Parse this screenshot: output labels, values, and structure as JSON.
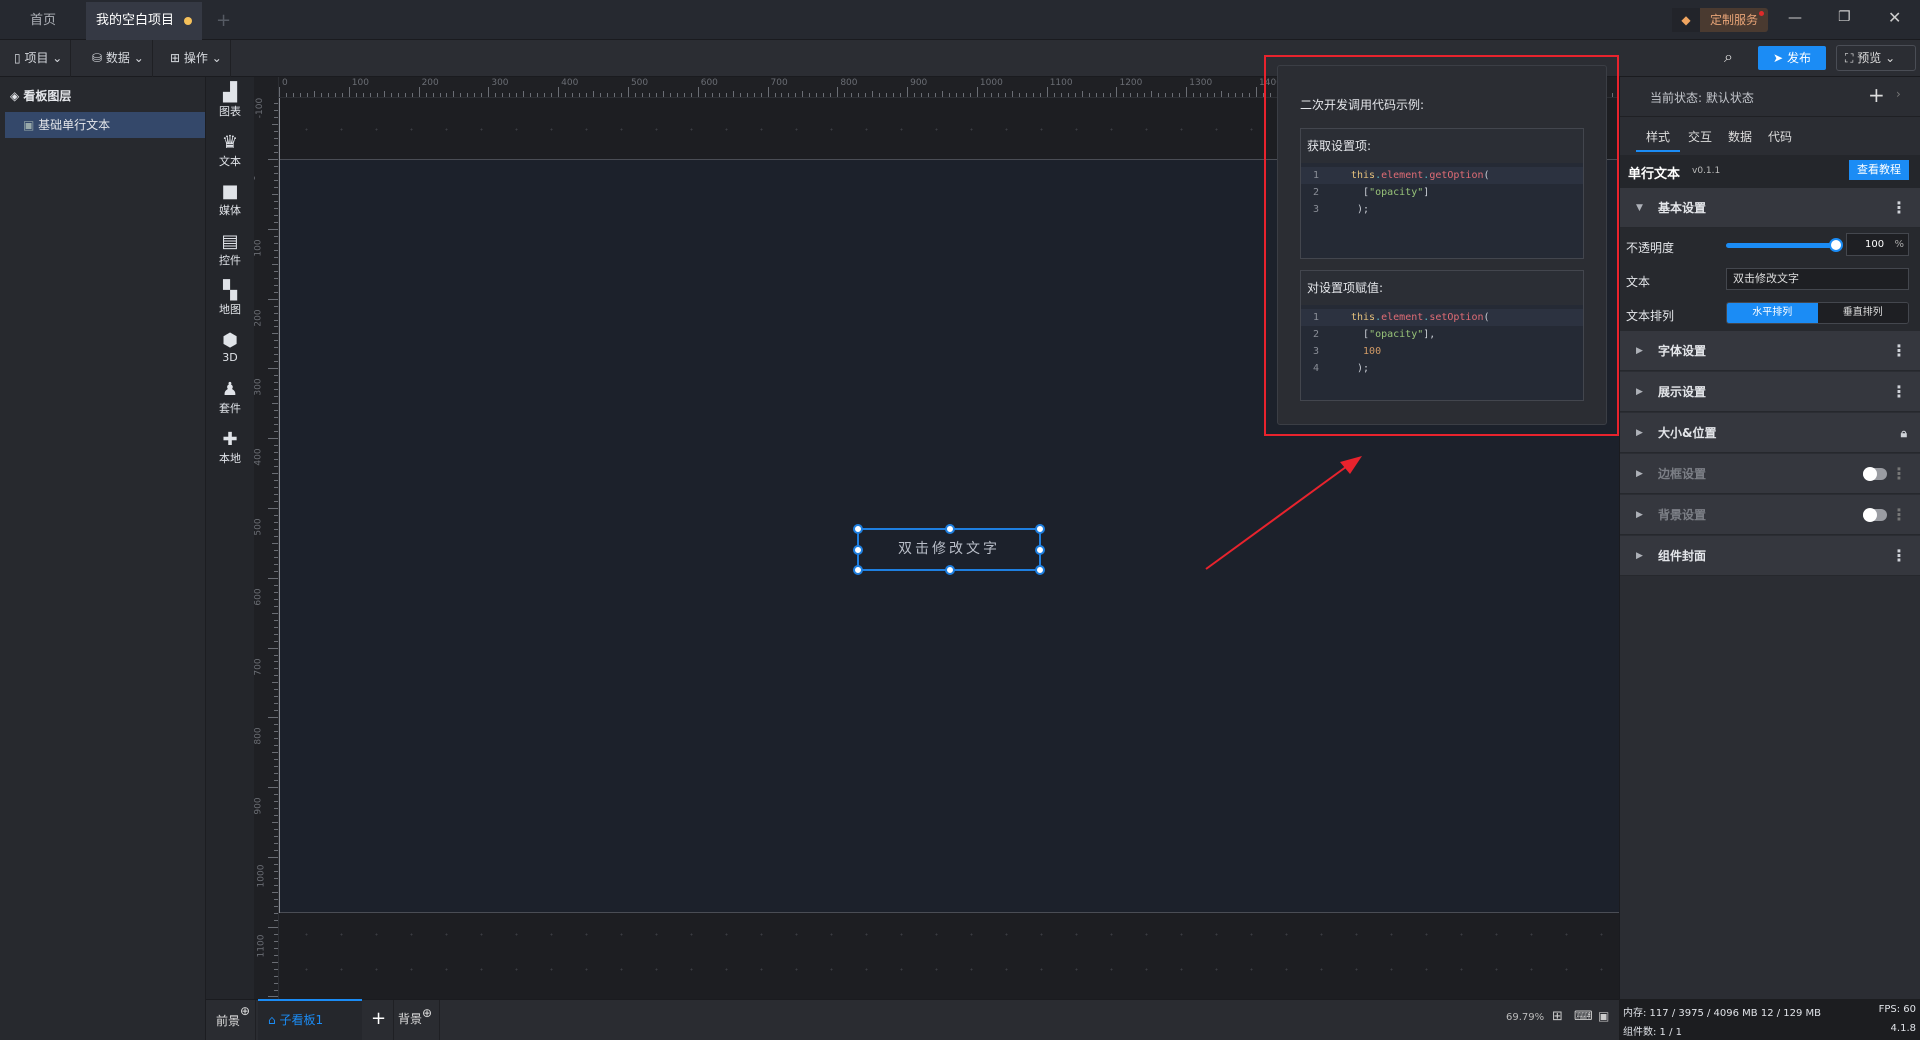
{
  "titlebar": {
    "tabs": [
      {
        "label": "首页"
      },
      {
        "label": "我的空白项目"
      }
    ],
    "add_tab": "+",
    "custom_service": "定制服务"
  },
  "toolbar": {
    "menus": [
      {
        "label": "项目"
      },
      {
        "label": "数据"
      },
      {
        "label": "操作"
      }
    ],
    "publish": "发布",
    "preview": "预览"
  },
  "layers": {
    "title": "看板图层",
    "items": [
      {
        "label": "基础单行文本"
      }
    ]
  },
  "iconbar": [
    {
      "label": "图表",
      "icon": "chart-icon"
    },
    {
      "label": "文本",
      "icon": "text-icon"
    },
    {
      "label": "媒体",
      "icon": "media-icon"
    },
    {
      "label": "控件",
      "icon": "control-icon"
    },
    {
      "label": "地图",
      "icon": "map-icon"
    },
    {
      "label": "3D",
      "icon": "cube-icon"
    },
    {
      "label": "套件",
      "icon": "kit-icon"
    },
    {
      "label": "本地",
      "icon": "puzzle-icon"
    }
  ],
  "ruler": {
    "h_labels": [
      0,
      100,
      200,
      300,
      400,
      500,
      600,
      700,
      800,
      900,
      1000,
      1100,
      1200,
      1300,
      1400
    ],
    "v_labels": [
      -100,
      0,
      100,
      200,
      300,
      400,
      500,
      600,
      700,
      800,
      900,
      1000,
      1100
    ]
  },
  "canvas": {
    "element_text": "双击修改文字"
  },
  "popup": {
    "title": "二次开发调用代码示例:",
    "get": {
      "title": "获取设置项:",
      "lines": [
        [
          [
            "kw",
            "this"
          ],
          [
            "dot",
            "."
          ],
          [
            "fn",
            "element"
          ],
          [
            "dot",
            "."
          ],
          [
            "fn",
            "getOption"
          ],
          [
            "p",
            "("
          ]
        ],
        [
          [
            "p",
            "  ["
          ],
          [
            "str",
            "\"opacity\""
          ],
          [
            "p",
            "]"
          ]
        ],
        [
          [
            "p",
            " );"
          ]
        ]
      ]
    },
    "set": {
      "title": "对设置项赋值:",
      "lines": [
        [
          [
            "kw",
            "this"
          ],
          [
            "dot",
            "."
          ],
          [
            "fn",
            "element"
          ],
          [
            "dot",
            "."
          ],
          [
            "fn",
            "setOption"
          ],
          [
            "p",
            "("
          ]
        ],
        [
          [
            "p",
            "  ["
          ],
          [
            "str",
            "\"opacity\""
          ],
          [
            "p",
            "],"
          ]
        ],
        [
          [
            "num",
            "  100"
          ]
        ],
        [
          [
            "p",
            " );"
          ]
        ]
      ]
    }
  },
  "rightpanel": {
    "state_label": "当前状态:",
    "state_value": "默认状态",
    "tabs": [
      "样式",
      "交互",
      "数据",
      "代码"
    ],
    "component_name": "单行文本",
    "version": "v0.1.1",
    "tutorial": "查看教程",
    "basic": {
      "title": "基本设置",
      "opacity_label": "不透明度",
      "opacity_value": "100",
      "opacity_unit": "%",
      "opacity_fraction": 1.0,
      "text_label": "文本",
      "text_value": "双击修改文字",
      "arrange_label": "文本排列",
      "arrange_options": [
        "水平排列",
        "垂直排列"
      ]
    },
    "sections": [
      {
        "title": "字体设置",
        "state": "menu"
      },
      {
        "title": "展示设置",
        "state": "menu"
      },
      {
        "title": "大小&位置",
        "state": "lock"
      },
      {
        "title": "边框设置",
        "state": "toggle"
      },
      {
        "title": "背景设置",
        "state": "toggle"
      },
      {
        "title": "组件封面",
        "state": "menu"
      }
    ]
  },
  "bottombar": {
    "foreground": "前景",
    "subboard": "子看板1",
    "background": "背景",
    "zoom": "69.79%"
  },
  "status": {
    "memory": "内存: 117 / 3975 / 4096 MB  12 / 129 MB",
    "fps": "FPS:  60",
    "components": "组件数: 1 / 1",
    "version": "4.1.8"
  }
}
